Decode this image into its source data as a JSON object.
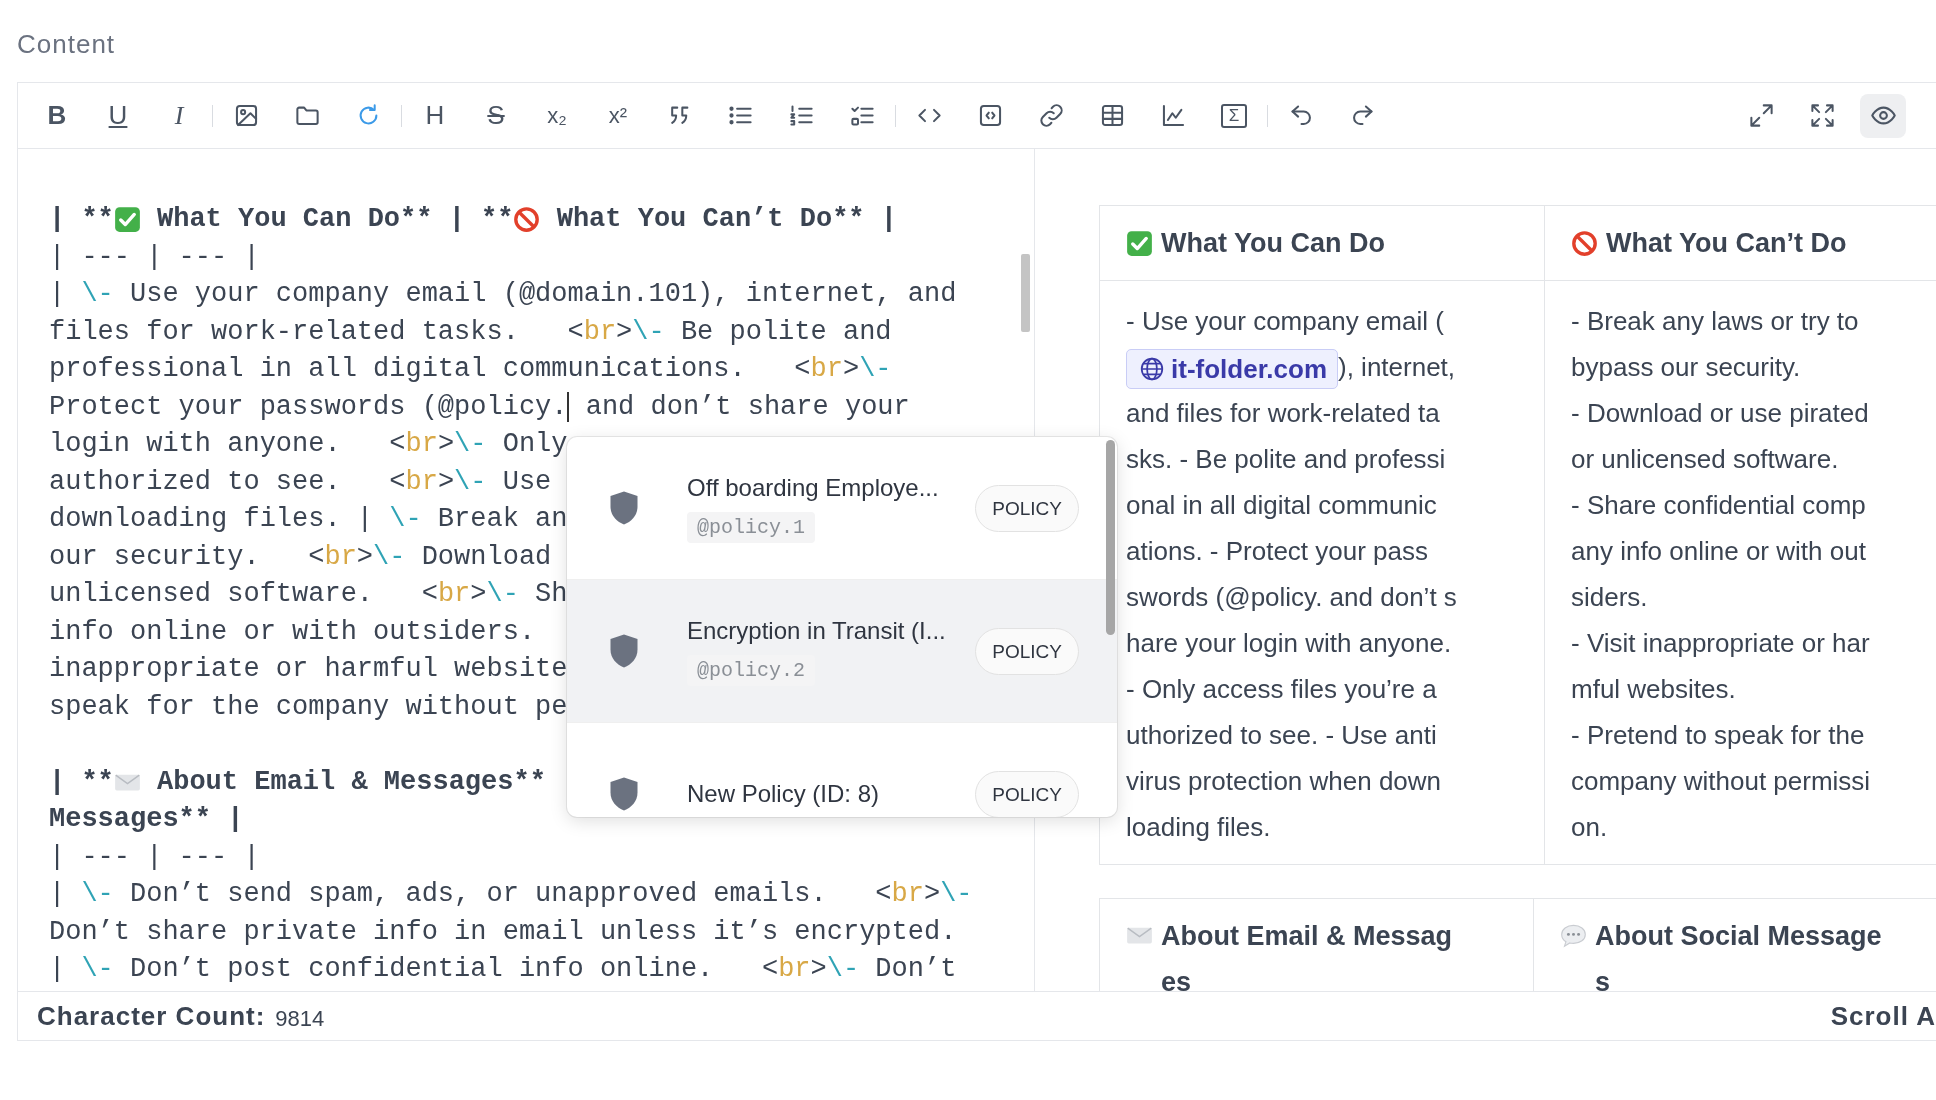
{
  "section_label": "Content",
  "toolbar": {
    "left_groups": [
      [
        {
          "kind": "bold_glyph",
          "text": "B",
          "selected": false
        },
        {
          "kind": "underline_glyph",
          "text": "U",
          "selected": false
        },
        {
          "kind": "italic_glyph",
          "text": "I",
          "selected": false
        }
      ],
      [
        {
          "kind": "image",
          "selected": false
        },
        {
          "kind": "folder",
          "selected": false
        },
        {
          "kind": "refresh",
          "selected": false
        }
      ],
      [
        {
          "kind": "heading_glyph",
          "text": "H",
          "selected": false
        },
        {
          "kind": "strike_glyph",
          "text": "S",
          "selected": false
        },
        {
          "kind": "subscript_glyph",
          "text": "x₂",
          "selected": false
        },
        {
          "kind": "superscript_glyph",
          "text": "x²",
          "selected": false
        },
        {
          "kind": "quote",
          "selected": false
        },
        {
          "kind": "bullet_list",
          "selected": false
        },
        {
          "kind": "numbered_list",
          "selected": false
        },
        {
          "kind": "task_list",
          "selected": false
        }
      ],
      [
        {
          "kind": "code",
          "selected": false
        },
        {
          "kind": "code_block",
          "selected": false
        },
        {
          "kind": "link",
          "selected": false
        },
        {
          "kind": "table",
          "selected": false
        },
        {
          "kind": "chart",
          "selected": false
        },
        {
          "kind": "formula_glyph",
          "text": "Σ",
          "selected": false
        }
      ],
      [
        {
          "kind": "undo",
          "selected": false
        },
        {
          "kind": "redo",
          "selected": false
        }
      ]
    ],
    "right_items": [
      {
        "kind": "expand",
        "selected": false
      },
      {
        "kind": "fullscreen",
        "selected": false
      },
      {
        "kind": "preview",
        "selected": true
      }
    ]
  },
  "editor_lines": [
    {
      "kind": "heading",
      "tokens": [
        {
          "kind": "text",
          "text": "| **"
        },
        {
          "kind": "check_emoji"
        },
        {
          "kind": "text",
          "text": " What You Can Do** | **"
        },
        {
          "kind": "prohibited_emoji"
        },
        {
          "kind": "text",
          "text": " What You Can’t Do** |"
        }
      ]
    },
    {
      "kind": "text",
      "tokens": [
        {
          "kind": "text",
          "text": "| --- | --- |"
        }
      ]
    },
    {
      "kind": "text",
      "tokens": [
        {
          "kind": "text",
          "text": "| "
        },
        {
          "kind": "escape",
          "text": "\\-"
        },
        {
          "kind": "text",
          "text": " Use your company email (@domain.101), internet, and"
        }
      ]
    },
    {
      "kind": "text",
      "tokens": [
        {
          "kind": "text",
          "text": "files for work-related tasks.   <"
        },
        {
          "kind": "tag",
          "text": "br"
        },
        {
          "kind": "text",
          "text": ">"
        },
        {
          "kind": "escape",
          "text": "\\-"
        },
        {
          "kind": "text",
          "text": " Be polite and"
        }
      ]
    },
    {
      "kind": "text",
      "tokens": [
        {
          "kind": "text",
          "text": "professional in all digital communications.   <"
        },
        {
          "kind": "tag",
          "text": "br"
        },
        {
          "kind": "text",
          "text": ">"
        },
        {
          "kind": "escape",
          "text": "\\-"
        }
      ]
    },
    {
      "kind": "text",
      "tokens": [
        {
          "kind": "text",
          "text": "Protect your passwords (@policy."
        },
        {
          "kind": "cursor"
        },
        {
          "kind": "text",
          "text": " and don’t share your"
        }
      ]
    },
    {
      "kind": "text",
      "tokens": [
        {
          "kind": "text",
          "text": "login with anyone.   <"
        },
        {
          "kind": "tag",
          "text": "br"
        },
        {
          "kind": "text",
          "text": ">"
        },
        {
          "kind": "escape",
          "text": "\\-"
        },
        {
          "kind": "text",
          "text": " Only"
        }
      ]
    },
    {
      "kind": "text",
      "tokens": [
        {
          "kind": "text",
          "text": "authorized to see.   <"
        },
        {
          "kind": "tag",
          "text": "br"
        },
        {
          "kind": "text",
          "text": ">"
        },
        {
          "kind": "escape",
          "text": "\\-"
        },
        {
          "kind": "text",
          "text": " Use"
        }
      ]
    },
    {
      "kind": "text",
      "tokens": [
        {
          "kind": "text",
          "text": "downloading files. | "
        },
        {
          "kind": "escape",
          "text": "\\-"
        },
        {
          "kind": "text",
          "text": " Break an"
        }
      ]
    },
    {
      "kind": "text",
      "tokens": [
        {
          "kind": "text",
          "text": "our security.   <"
        },
        {
          "kind": "tag",
          "text": "br"
        },
        {
          "kind": "text",
          "text": ">"
        },
        {
          "kind": "escape",
          "text": "\\-"
        },
        {
          "kind": "text",
          "text": " Download"
        }
      ]
    },
    {
      "kind": "text",
      "tokens": [
        {
          "kind": "text",
          "text": "unlicensed software.   <"
        },
        {
          "kind": "tag",
          "text": "br"
        },
        {
          "kind": "text",
          "text": ">"
        },
        {
          "kind": "escape",
          "text": "\\-"
        },
        {
          "kind": "text",
          "text": " Sh"
        }
      ]
    },
    {
      "kind": "text",
      "tokens": [
        {
          "kind": "text",
          "text": "info online or with outsiders."
        }
      ]
    },
    {
      "kind": "text",
      "tokens": [
        {
          "kind": "text",
          "text": "inappropriate or harmful website"
        }
      ]
    },
    {
      "kind": "text",
      "tokens": [
        {
          "kind": "text",
          "text": "speak for the company without pe"
        }
      ]
    },
    {
      "kind": "blank"
    },
    {
      "kind": "heading",
      "tokens": [
        {
          "kind": "text",
          "text": "| **"
        },
        {
          "kind": "envelope_emoji"
        },
        {
          "kind": "text",
          "text": " About Email & Messages**"
        }
      ]
    },
    {
      "kind": "heading",
      "tokens": [
        {
          "kind": "text",
          "text": "Messages** |"
        }
      ]
    },
    {
      "kind": "text",
      "tokens": [
        {
          "kind": "text",
          "text": "| --- | --- |"
        }
      ]
    },
    {
      "kind": "text",
      "tokens": [
        {
          "kind": "text",
          "text": "| "
        },
        {
          "kind": "escape",
          "text": "\\-"
        },
        {
          "kind": "text",
          "text": " Don’t send spam, ads, or unapproved emails.   <"
        },
        {
          "kind": "tag",
          "text": "br"
        },
        {
          "kind": "text",
          "text": ">"
        },
        {
          "kind": "escape",
          "text": "\\-"
        }
      ]
    },
    {
      "kind": "text",
      "tokens": [
        {
          "kind": "text",
          "text": "Don’t share private info in email unless it’s encrypted."
        }
      ]
    },
    {
      "kind": "text",
      "tokens": [
        {
          "kind": "text",
          "text": "| "
        },
        {
          "kind": "escape",
          "text": "\\-"
        },
        {
          "kind": "text",
          "text": " Don’t post confidential info online.   <"
        },
        {
          "kind": "tag",
          "text": "br"
        },
        {
          "kind": "text",
          "text": ">"
        },
        {
          "kind": "escape",
          "text": "\\-"
        },
        {
          "kind": "text",
          "text": " Don’t"
        }
      ]
    }
  ],
  "mention_popup": {
    "items": [
      {
        "title": "Off boarding Employe...",
        "code": "@policy.1",
        "tag": "POLICY",
        "selected": false
      },
      {
        "title": "Encryption in Transit (I...",
        "code": "@policy.2",
        "tag": "POLICY",
        "selected": true
      },
      {
        "title": "New Policy (ID: 8)",
        "tag": "POLICY",
        "selected": false
      }
    ]
  },
  "preview_tables": [
    {
      "headers": [
        {
          "kind": "check_emoji",
          "lines": [
            "What You Can Do"
          ]
        },
        {
          "kind": "prohibited_emoji",
          "lines": [
            "What You Can’t Do"
          ]
        }
      ],
      "cells": [
        {
          "lines": [
            {
              "text": "- Use your company email ("
            },
            {
              "link": "it-folder.com",
              "text": "), internet,"
            },
            {
              "text": "and files for work-related ta"
            },
            {
              "text": "sks. - Be polite and professi"
            },
            {
              "text": "onal in all digital communic"
            },
            {
              "text": "ations. - Protect your pass"
            },
            {
              "text": "swords (@policy. and don’t s"
            },
            {
              "text": "hare your login with anyone."
            },
            {
              "text": "- Only access files you’re a"
            },
            {
              "text": "uthorized to see. - Use anti"
            },
            {
              "text": "virus protection when down"
            },
            {
              "text": "loading files."
            }
          ]
        },
        {
          "lines": [
            {
              "text": "- Break any laws or try to"
            },
            {
              "text": "bypass our security."
            },
            {
              "text": "- Download or use pirated"
            },
            {
              "text": "or unlicensed software."
            },
            {
              "text": "- Share confidential comp"
            },
            {
              "text": "any info online or with out"
            },
            {
              "text": "siders."
            },
            {
              "text": "- Visit inappropriate or har"
            },
            {
              "text": "mful websites."
            },
            {
              "text": "- Pretend to speak for the"
            },
            {
              "text": "company without permissi"
            },
            {
              "text": "on."
            }
          ]
        }
      ]
    },
    {
      "headers": [
        {
          "kind": "envelope_emoji",
          "lines": [
            "About Email & Messag",
            "es"
          ]
        },
        {
          "kind": "speech_emoji",
          "lines": [
            "About Social Message",
            "s"
          ]
        }
      ]
    }
  ],
  "status_bar": {
    "label": "Character Count:",
    "count": "9814",
    "right_text": "Scroll A"
  }
}
